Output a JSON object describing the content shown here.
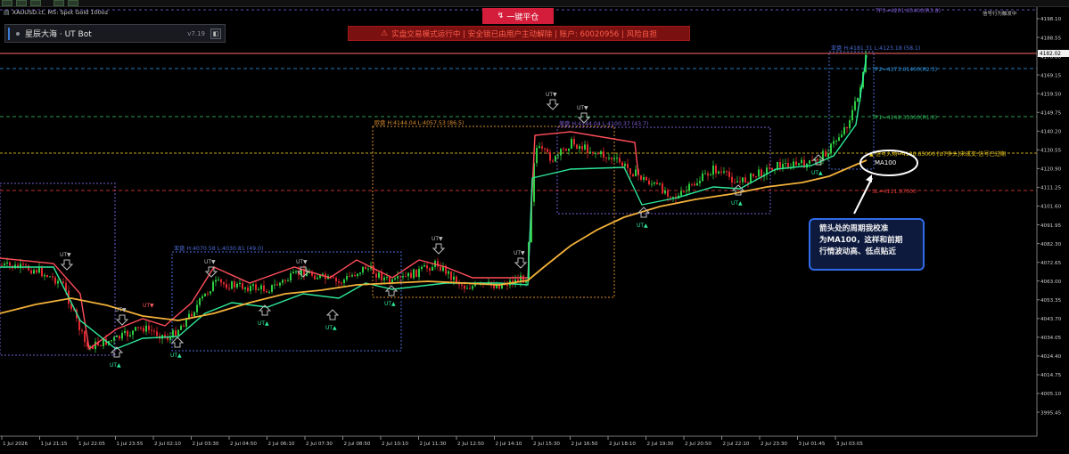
{
  "symbol_line": {
    "text": "XAUUSD.ct, M5: Spot Gold 100oz"
  },
  "bot_panel": {
    "name": "星辰大海 · UT Bot",
    "version": "v7.19",
    "button_glyph": "◧"
  },
  "close_all_button": {
    "label": "一键平仓",
    "icon": "↯"
  },
  "warning_banner": {
    "icon": "⚠",
    "text": "实盘交易模式运行中 | 安全锁已由用户主动解除 | 账户: 60020956 | 风险自担"
  },
  "top_right_info": "信号行为触发中",
  "annotation": {
    "lines": [
      "箭头处的周期我校准",
      "为MA100，这样和前期",
      "行情波动高、低点贴近"
    ],
    "ellipse_label": "MA100"
  },
  "price_axis": {
    "ticks": [
      "4198.10",
      "4188.55",
      "4178.80",
      "4169.15",
      "4159.50",
      "4149.75",
      "4140.20",
      "4130.55",
      "4120.90",
      "4111.25",
      "4101.60",
      "4091.95",
      "4082.30",
      "4072.65",
      "4063.00",
      "4053.35",
      "4043.70",
      "4034.05",
      "4024.40",
      "4014.75",
      "4005.10",
      "3995.45"
    ],
    "current_price": "4182.02"
  },
  "time_axis": {
    "ticks": [
      "1 Jul 2026",
      "1 Jul 21:15",
      "1 Jul 22:05",
      "1 Jul 23:55",
      "2 Jul 02:10",
      "2 Jul 03:30",
      "2 Jul 04:50",
      "2 Jul 06:10",
      "2 Jul 07:30",
      "2 Jul 08:50",
      "2 Jul 10:10",
      "2 Jul 11:30",
      "2 Jul 12:50",
      "2 Jul 14:10",
      "2 Jul 15:30",
      "2 Jul 16:50",
      "2 Jul 18:10",
      "2 Jul 19:30",
      "2 Jul 20:50",
      "2 Jul 22:10",
      "2 Jul 23:30",
      "3 Jul 01:45",
      "3 Jul 03:05"
    ]
  },
  "levels": {
    "tp3": "TP3=4201.63400(R3.8)",
    "tp2": "TP2=4173.61400(R2.3)",
    "tp1": "TP1=4149.33000(R1.0)",
    "entry": "▲ 信号入场=4130.65000 [UT多头]未成交:信号已过期",
    "sl": "SL=4111.97000"
  },
  "sessions": {
    "asia": "亚盘 H:4070.58 L:4030.81 (49.0)",
    "europe": "欧盘 H:4144.04 L:4057.53 (86.5)",
    "us": "美盘 H:4144.04 L:4100.37 (43.7)",
    "asia_latest": "亚盘 H:4181.31 L:4123.18 (58.1)"
  },
  "signals": {
    "buy_label": "UT▲",
    "sell_label": "UT▼"
  },
  "colors": {
    "bull": "#2ecc40",
    "bear": "#e0282e",
    "trail_red": "#ff4d5a",
    "trail_green": "#2de89a",
    "ma100": "#f3b13a",
    "tp_blue": "#2f8fd8",
    "tp_green": "#2fb65a",
    "entry_yellow": "#e4c21e",
    "sl_red": "#e03a3a",
    "session_blue": "#4a6bd6",
    "session_orange": "#d98c2e",
    "session_purple": "#7a5ad0",
    "callout_border": "#2f6be8"
  }
}
